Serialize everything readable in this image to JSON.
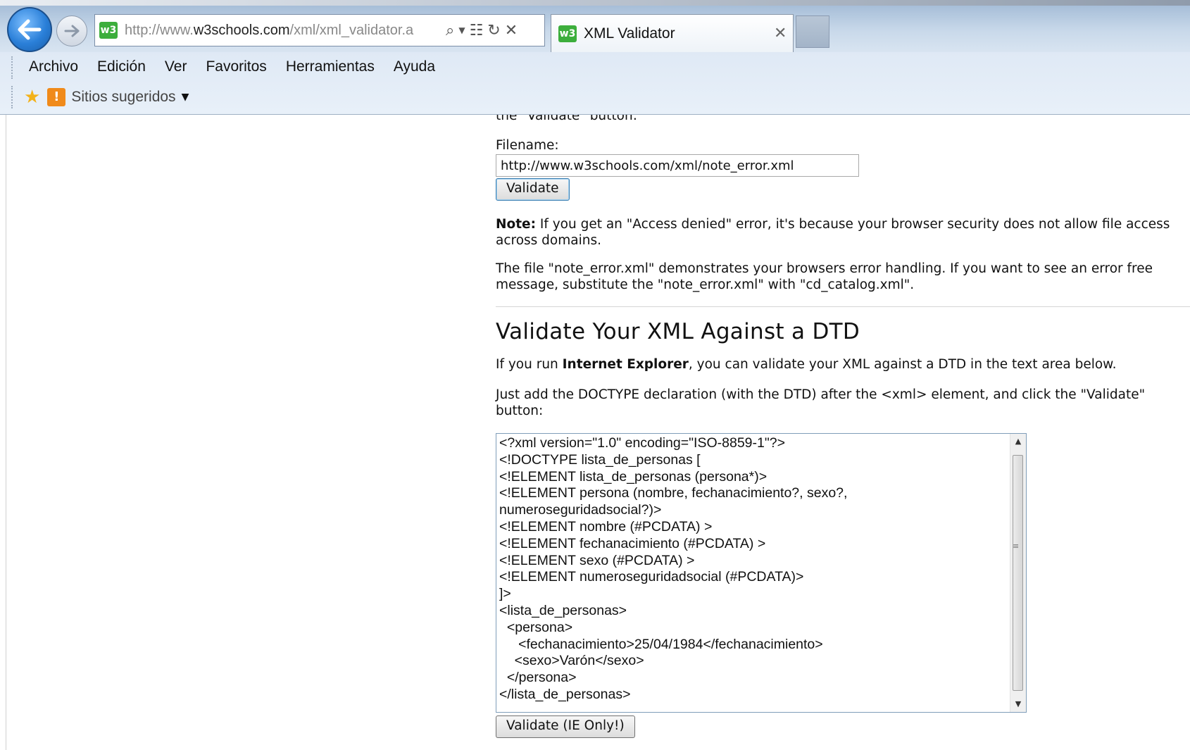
{
  "browser": {
    "url_prefix": "http://www.",
    "url_domain": "w3schools.com",
    "url_suffix": "/xml/xml_validator.a",
    "tab_title": "XML Validator",
    "logo_text": "w3"
  },
  "menu": {
    "items": [
      "Archivo",
      "Edición",
      "Ver",
      "Favoritos",
      "Herramientas",
      "Ayuda"
    ],
    "suggested_sites": "Sitios sugeridos"
  },
  "page": {
    "cut_line": "the \"Validate\" button:",
    "filename_label": "Filename:",
    "filename_value": "http://www.w3schools.com/xml/note_error.xml",
    "validate_label": "Validate",
    "note_bold": "Note:",
    "note_text": " If you get an \"Access denied\" error, it's because your browser security does not allow file access across domains.",
    "file_para": "The file \"note_error.xml\" demonstrates your browsers error handling. If you want to see an error free message, substitute the \"note_error.xml\" with \"cd_catalog.xml\".",
    "dtd_heading": "Validate Your XML Against a DTD",
    "ie_prefix": "If you run ",
    "ie_bold": "Internet Explorer",
    "ie_suffix": ", you can validate your XML against a DTD in the text area below.",
    "doctype_para": "Just add the DOCTYPE declaration (with the DTD) after the <xml> element, and click the \"Validate\" button:",
    "xml_content": "<?xml version=\"1.0\" encoding=\"ISO-8859-1\"?>\n<!DOCTYPE lista_de_personas [\n<!ELEMENT lista_de_personas (persona*)>\n<!ELEMENT persona (nombre, fechanacimiento?, sexo?,\nnumeroseguridadsocial?)>\n<!ELEMENT nombre (#PCDATA) >\n<!ELEMENT fechanacimiento (#PCDATA) >\n<!ELEMENT sexo (#PCDATA) >\n<!ELEMENT numeroseguridadsocial (#PCDATA)>\n]>\n<lista_de_personas>\n  <persona>\n     <fechanacimiento>25/04/1984</fechanacimiento>\n    <sexo>Varón</sexo>\n  </persona>\n</lista_de_personas>",
    "validate_ie_label": "Validate (IE Only!)"
  }
}
